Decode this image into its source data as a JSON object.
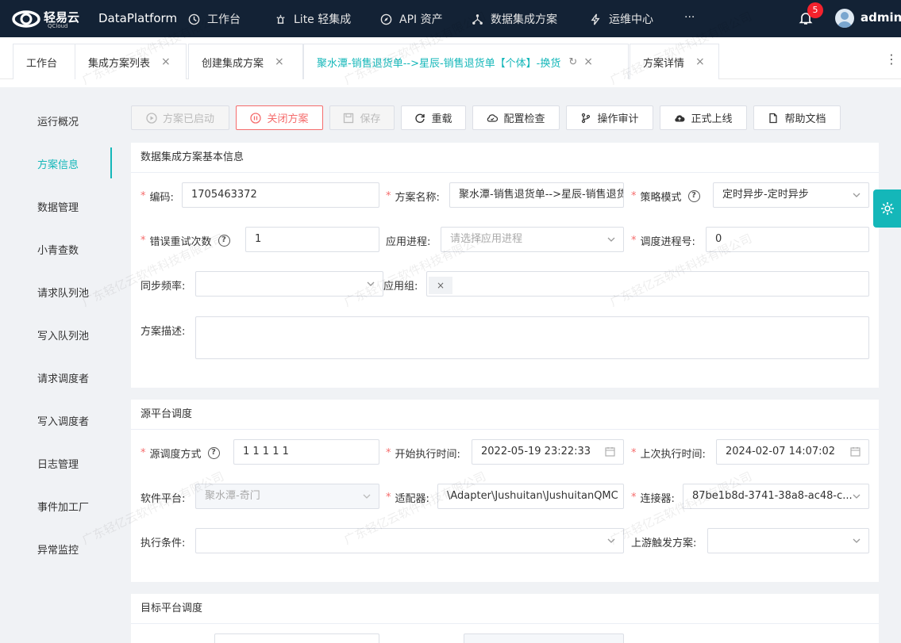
{
  "app": {
    "logo_text": "轻易云",
    "logo_sub": "QCloud",
    "brand": "DataPlatform"
  },
  "nav": [
    {
      "label": "工作台",
      "icon": "clock-icon"
    },
    {
      "label": "Lite 轻集成",
      "icon": "lamp-icon"
    },
    {
      "label": "API 资产",
      "icon": "compass-icon"
    },
    {
      "label": "数据集成方案",
      "icon": "share-icon"
    },
    {
      "label": "运维中心",
      "icon": "bolt-icon"
    },
    {
      "label": "···",
      "icon": ""
    }
  ],
  "notifications": {
    "count": "5"
  },
  "user": {
    "name": "admin"
  },
  "tabs": [
    {
      "label": "工作台",
      "closable": false
    },
    {
      "label": "集成方案列表",
      "closable": true
    },
    {
      "label": "创建集成方案",
      "closable": true
    },
    {
      "label": "聚水潭-销售退货单-->星辰-销售退货单【个体】-换货",
      "closable": true,
      "active": true
    },
    {
      "label": "方案详情",
      "closable": true
    }
  ],
  "sidebar": {
    "items": [
      {
        "label": "运行概况"
      },
      {
        "label": "方案信息",
        "active": true
      },
      {
        "label": "数据管理"
      },
      {
        "label": "小青查数"
      },
      {
        "label": "请求队列池"
      },
      {
        "label": "写入队列池"
      },
      {
        "label": "请求调度者"
      },
      {
        "label": "写入调度者"
      },
      {
        "label": "日志管理"
      },
      {
        "label": "事件加工厂"
      },
      {
        "label": "异常监控"
      }
    ]
  },
  "toolbar": {
    "started": "方案已启动",
    "close": "关闭方案",
    "save": "保存",
    "reload": "重载",
    "config_check": "配置检查",
    "audit": "操作审计",
    "go_live": "正式上线",
    "help_doc": "帮助文档"
  },
  "basic": {
    "title": "数据集成方案基本信息",
    "code_label": "编码:",
    "code_value": "1705463372",
    "name_label": "方案名称:",
    "name_value": "聚水潭-销售退货单-->星辰-销售退货单【个体】-换货",
    "strategy_label": "策略模式",
    "strategy_value": "定时异步-定时异步",
    "retry_label": "错误重试次数",
    "retry_value": "1",
    "app_process_label": "应用进程:",
    "app_process_placeholder": "请选择应用进程",
    "sched_no_label": "调度进程号:",
    "sched_no_value": "0",
    "sync_freq_label": "同步频率:",
    "app_group_label": "应用组:",
    "app_group_tag": "×",
    "desc_label": "方案描述:"
  },
  "source": {
    "title": "源平台调度",
    "mode_label": "源调度方式",
    "mode_value": "1 1 1 1 1",
    "start_label": "开始执行时间:",
    "start_value": "2022-05-19 23:22:33",
    "last_label": "上次执行时间:",
    "last_value": "2024-02-07 14:07:02",
    "platform_label": "软件平台:",
    "platform_value": "聚水潭-奇门",
    "adapter_label": "适配器:",
    "adapter_value": "\\Adapter\\Jushuitan\\JushuitanQMC",
    "connector_label": "连接器:",
    "connector_value": "87be1b8d-3741-38a8-ac48-c...",
    "condition_label": "执行条件:",
    "upstream_label": "上游触发方案:"
  },
  "target": {
    "title": "目标平台调度"
  },
  "watermark": "广东轻亿云软件科技有限公司"
}
